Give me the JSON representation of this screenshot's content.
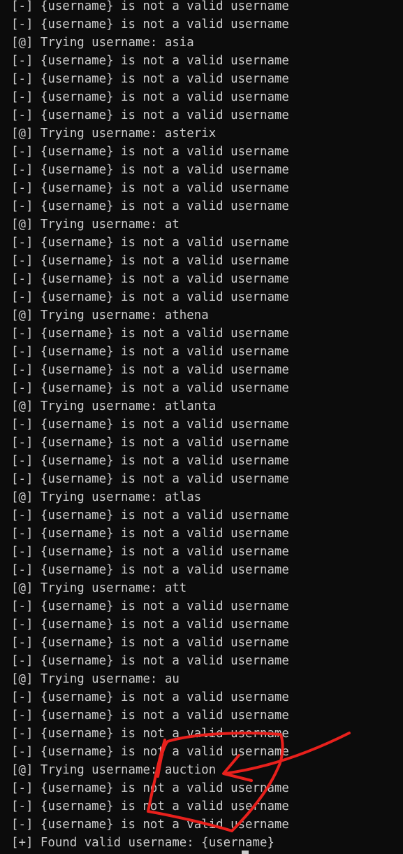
{
  "terminal": {
    "lines": [
      "[-] {username} is not a valid username",
      "[-] {username} is not a valid username",
      "[@] Trying username: asia",
      "[-] {username} is not a valid username",
      "[-] {username} is not a valid username",
      "[-] {username} is not a valid username",
      "[-] {username} is not a valid username",
      "[@] Trying username: asterix",
      "[-] {username} is not a valid username",
      "[-] {username} is not a valid username",
      "[-] {username} is not a valid username",
      "[-] {username} is not a valid username",
      "[@] Trying username: at",
      "[-] {username} is not a valid username",
      "[-] {username} is not a valid username",
      "[-] {username} is not a valid username",
      "[-] {username} is not a valid username",
      "[@] Trying username: athena",
      "[-] {username} is not a valid username",
      "[-] {username} is not a valid username",
      "[-] {username} is not a valid username",
      "[-] {username} is not a valid username",
      "[@] Trying username: atlanta",
      "[-] {username} is not a valid username",
      "[-] {username} is not a valid username",
      "[-] {username} is not a valid username",
      "[-] {username} is not a valid username",
      "[@] Trying username: atlas",
      "[-] {username} is not a valid username",
      "[-] {username} is not a valid username",
      "[-] {username} is not a valid username",
      "[-] {username} is not a valid username",
      "[@] Trying username: att",
      "[-] {username} is not a valid username",
      "[-] {username} is not a valid username",
      "[-] {username} is not a valid username",
      "[-] {username} is not a valid username",
      "[@] Trying username: au",
      "[-] {username} is not a valid username",
      "[-] {username} is not a valid username",
      "[-] {username} is not a valid username",
      "[-] {username} is not a valid username",
      "[@] Trying username: auction",
      "[-] {username} is not a valid username",
      "[-] {username} is not a valid username",
      "[-] {username} is not a valid username",
      "[+] Found valid username: {username}"
    ]
  },
  "colors": {
    "background": "#0c0c0c",
    "text": "#cccccc",
    "annotation": "#e8201c"
  }
}
